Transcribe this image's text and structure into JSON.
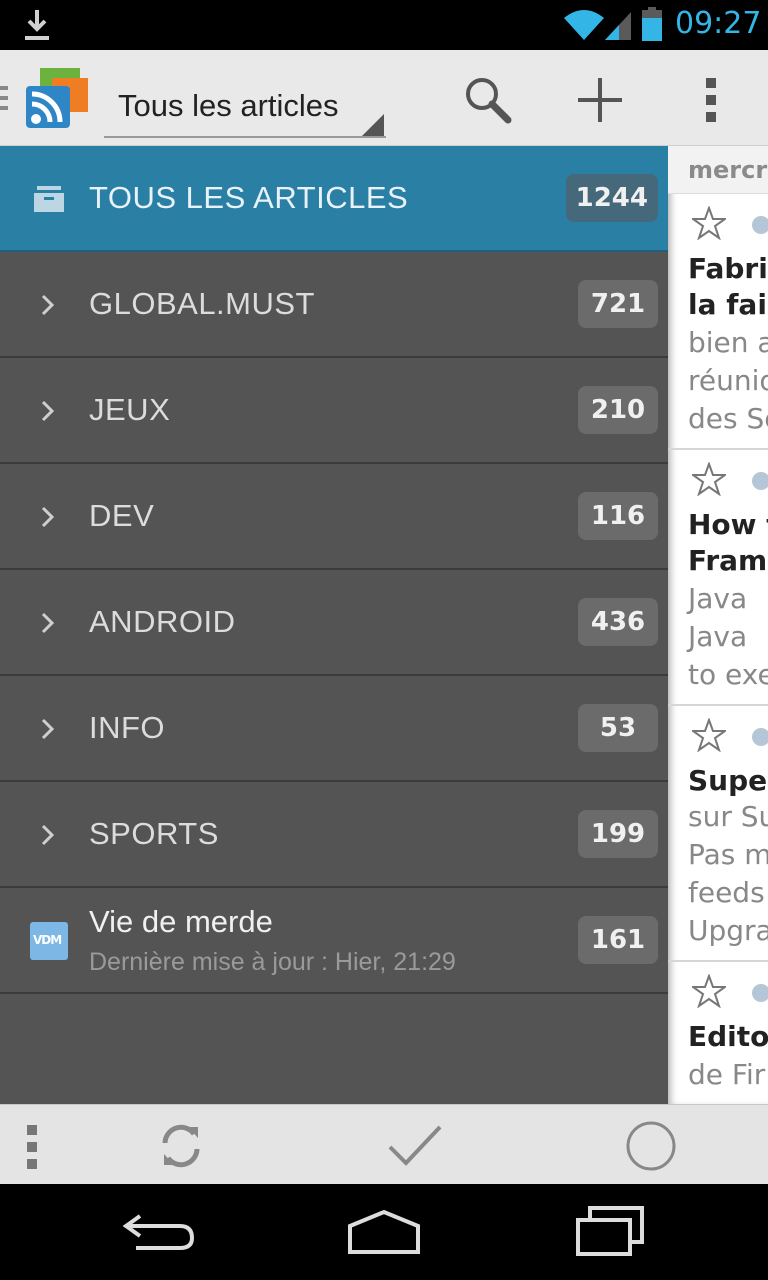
{
  "status_bar": {
    "time": "09:27",
    "icons": [
      "download-icon",
      "wifi-icon",
      "signal-icon",
      "battery-icon"
    ],
    "accent_color": "#33b5e5"
  },
  "action_bar": {
    "spinner_title": "Tous les articles",
    "actions": [
      "search-icon",
      "add-icon",
      "overflow-icon"
    ]
  },
  "drawer": {
    "selected_color": "#2a7fa4",
    "items": [
      {
        "label": "TOUS LES ARTICLES",
        "count": "1244",
        "icon": "archive-icon",
        "selected": true
      },
      {
        "label": "GLOBAL.MUST",
        "count": "721",
        "icon": "chevron-right-icon"
      },
      {
        "label": "JEUX",
        "count": "210",
        "icon": "chevron-right-icon"
      },
      {
        "label": "DEV",
        "count": "116",
        "icon": "chevron-right-icon"
      },
      {
        "label": "ANDROID",
        "count": "436",
        "icon": "chevron-right-icon"
      },
      {
        "label": "INFO",
        "count": "53",
        "icon": "chevron-right-icon"
      },
      {
        "label": "SPORTS",
        "count": "199",
        "icon": "chevron-right-icon"
      }
    ],
    "feed": {
      "badge": "VDM",
      "title": "Vie de merde",
      "subtitle": "Dernière mise à jour : Hier, 21:29",
      "count": "161"
    }
  },
  "article_list": {
    "date_header": "mercre",
    "cards": [
      {
        "title_lines": [
          "Fabric",
          "la fair"
        ],
        "text_lines": [
          "bien a",
          "réunio",
          "des Se"
        ]
      },
      {
        "title_lines": [
          "How t",
          "Frame"
        ],
        "text_lines": [
          "Java",
          "Java",
          "to exe"
        ]
      },
      {
        "title_lines": [
          "Super"
        ],
        "text_lines": [
          "sur Su",
          "Pas m",
          "feeds",
          "Upgra"
        ]
      },
      {
        "title_lines": [
          "Edito"
        ],
        "text_lines": [
          "de Fir"
        ]
      }
    ]
  },
  "bottom_toolbar": {
    "actions": [
      "overflow-icon",
      "refresh-icon",
      "mark-read-icon",
      "circle-icon"
    ]
  },
  "nav_bar": {
    "buttons": [
      "back-icon",
      "home-icon",
      "recents-icon"
    ]
  }
}
